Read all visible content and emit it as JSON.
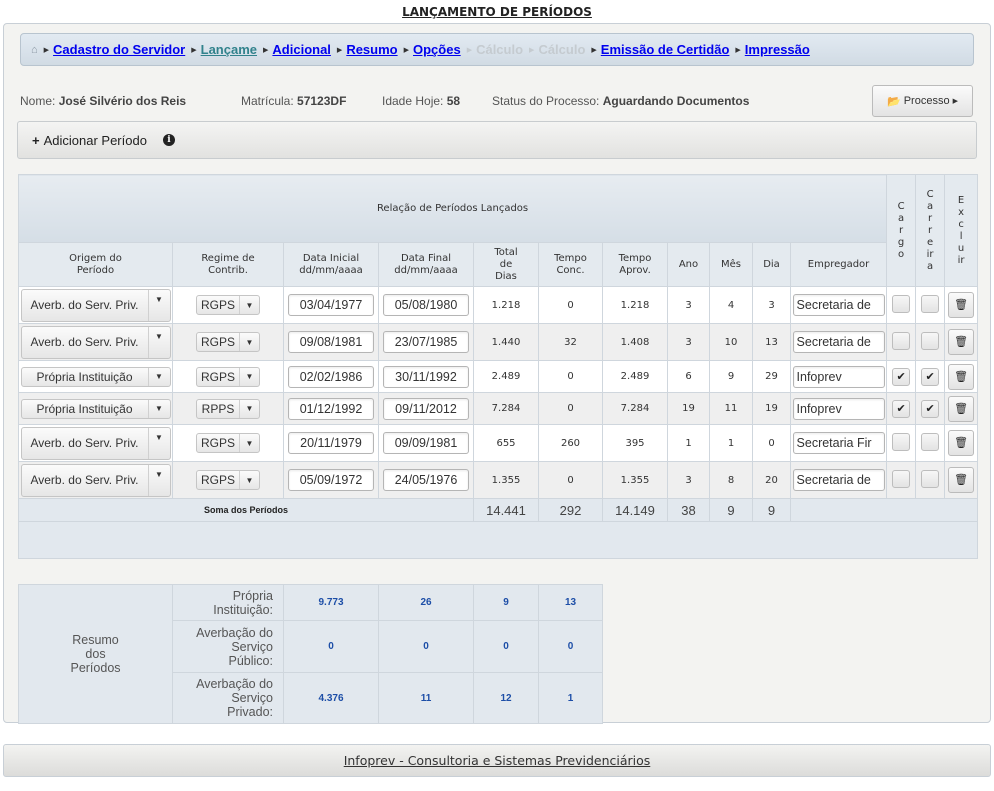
{
  "page_title": "LANÇAMENTO DE PERÍODOS",
  "breadcrumb": {
    "home_icon": "home-icon",
    "items": [
      {
        "label": "Cadastro do Servidor",
        "state": "link"
      },
      {
        "label": "Lançame",
        "state": "active"
      },
      {
        "label": "Adicional",
        "state": "link"
      },
      {
        "label": "Resumo",
        "state": "link"
      },
      {
        "label": "Opções",
        "state": "link"
      },
      {
        "label": "Cálculo",
        "state": "disabled"
      },
      {
        "label": "Cálculo",
        "state": "disabled"
      },
      {
        "label": "Emissão de Certidão",
        "state": "link"
      },
      {
        "label": "Impressão",
        "state": "link"
      }
    ]
  },
  "info": {
    "nome_label": "Nome:",
    "nome_value": "José Silvério dos Reis",
    "matricula_label": "Matrícula:",
    "matricula_value": "57123DF",
    "idade_label": "Idade Hoje:",
    "idade_value": "58",
    "status_label": "Status do Processo:",
    "status_value": "Aguardando Documentos"
  },
  "processo_button": {
    "label": "Processo",
    "icon": "folder-open-icon"
  },
  "add_period": {
    "plus": "+",
    "label": "Adicionar Período",
    "info_icon": "i"
  },
  "table": {
    "title": "Relação de Períodos Lançados",
    "headers": {
      "origem": "Origem do Período",
      "regime": "Regime de Contrib.",
      "data_inicial": "Data Inicial dd/mm/aaaa",
      "data_final": "Data Final dd/mm/aaaa",
      "total_dias": "Total de Dias",
      "tempo_conc": "Tempo Conc.",
      "tempo_aprov": "Tempo Aprov.",
      "ano": "Ano",
      "mes": "Mês",
      "dia": "Dia",
      "empregador": "Empregador",
      "cargo": "Cargo",
      "carreira": "Carreira",
      "excluir": "Excluir"
    },
    "rows": [
      {
        "origem": "Averb. do Serv. Priv.",
        "regime": "RGPS",
        "data_inicial": "03/04/1977",
        "data_final": "05/08/1980",
        "total_dias": "1.218",
        "tempo_conc": "0",
        "tempo_aprov": "1.218",
        "ano": "3",
        "mes": "4",
        "dia": "3",
        "empregador": "Secretaria de",
        "cargo": false,
        "carreira": false
      },
      {
        "origem": "Averb. do Serv. Priv.",
        "regime": "RGPS",
        "data_inicial": "09/08/1981",
        "data_final": "23/07/1985",
        "total_dias": "1.440",
        "tempo_conc": "32",
        "tempo_aprov": "1.408",
        "ano": "3",
        "mes": "10",
        "dia": "13",
        "empregador": "Secretaria de",
        "cargo": false,
        "carreira": false
      },
      {
        "origem": "Própria Instituição",
        "regime": "RGPS",
        "data_inicial": "02/02/1986",
        "data_final": "30/11/1992",
        "total_dias": "2.489",
        "tempo_conc": "0",
        "tempo_aprov": "2.489",
        "ano": "6",
        "mes": "9",
        "dia": "29",
        "empregador": "Infoprev",
        "cargo": true,
        "carreira": true
      },
      {
        "origem": "Própria Instituição",
        "regime": "RPPS",
        "data_inicial": "01/12/1992",
        "data_final": "09/11/2012",
        "total_dias": "7.284",
        "tempo_conc": "0",
        "tempo_aprov": "7.284",
        "ano": "19",
        "mes": "11",
        "dia": "19",
        "empregador": "Infoprev",
        "cargo": true,
        "carreira": true
      },
      {
        "origem": "Averb. do Serv. Priv.",
        "regime": "RGPS",
        "data_inicial": "20/11/1979",
        "data_final": "09/09/1981",
        "total_dias": "655",
        "tempo_conc": "260",
        "tempo_aprov": "395",
        "ano": "1",
        "mes": "1",
        "dia": "0",
        "empregador": "Secretaria Fir",
        "cargo": false,
        "carreira": false
      },
      {
        "origem": "Averb. do Serv. Priv.",
        "regime": "RGPS",
        "data_inicial": "05/09/1972",
        "data_final": "24/05/1976",
        "total_dias": "1.355",
        "tempo_conc": "0",
        "tempo_aprov": "1.355",
        "ano": "3",
        "mes": "8",
        "dia": "20",
        "empregador": "Secretaria de",
        "cargo": false,
        "carreira": false
      }
    ],
    "sum": {
      "label": "Soma dos Períodos",
      "total_dias": "14.441",
      "tempo_conc": "292",
      "tempo_aprov": "14.149",
      "ano": "38",
      "mes": "9",
      "dia": "9"
    }
  },
  "resumo": {
    "label": "Resumo dos Períodos",
    "rows": [
      {
        "label": "Própria Instituição:",
        "v1": "9.773",
        "v2": "26",
        "v3": "9",
        "v4": "13"
      },
      {
        "label": "Averbação do Serviço Público:",
        "v1": "0",
        "v2": "0",
        "v3": "0",
        "v4": "0"
      },
      {
        "label": "Averbação do Serviço Privado:",
        "v1": "4.376",
        "v2": "11",
        "v3": "12",
        "v4": "1"
      }
    ]
  },
  "footer": {
    "link": "Infoprev - Consultoria e Sistemas Previdenciários"
  },
  "colors": {
    "link": "#0000ee",
    "active_link": "#31828c",
    "disabled_link": "#c5cbd0",
    "resumo_value": "#1d4ea7",
    "header_bg": "#e4eaef"
  }
}
